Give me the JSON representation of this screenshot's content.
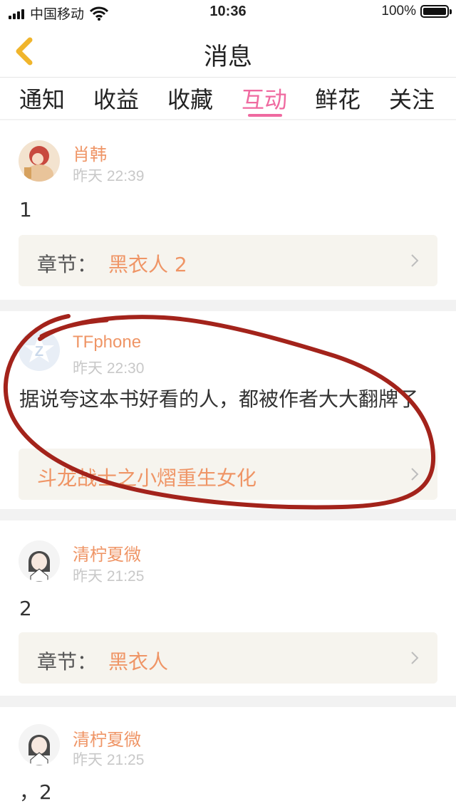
{
  "status_bar": {
    "carrier": "中国移动",
    "time": "10:36",
    "battery_percent_text": "100%",
    "battery_level": 1.0
  },
  "nav": {
    "title": "消息"
  },
  "tabs": [
    {
      "label": "通知",
      "active": false
    },
    {
      "label": "收益",
      "active": false
    },
    {
      "label": "收藏",
      "active": false
    },
    {
      "label": "互动",
      "active": true
    },
    {
      "label": "鲜花",
      "active": false
    },
    {
      "label": "关注",
      "active": false
    }
  ],
  "messages": [
    {
      "user": "肖韩",
      "time": "昨天 22:39",
      "text": "1",
      "ref_prefix": "章节：",
      "ref_title": "黑衣人 2"
    },
    {
      "user": "TFphone",
      "time": "昨天 22:30",
      "text": "据说夸这本书好看的人，都被作者大大翻牌了",
      "ref_prefix": "",
      "ref_title": "斗龙战士之小熠重生女化"
    },
    {
      "user": "清柠夏微",
      "time": "昨天 21:25",
      "text": "2",
      "ref_prefix": "章节：",
      "ref_title": "黑衣人"
    },
    {
      "user": "清柠夏微",
      "time": "昨天 21:25",
      "text": "，2"
    }
  ],
  "colors": {
    "accent_pink": "#ef6aa0",
    "username_orange": "#ef9566",
    "annotation_red": "#a3231b"
  }
}
